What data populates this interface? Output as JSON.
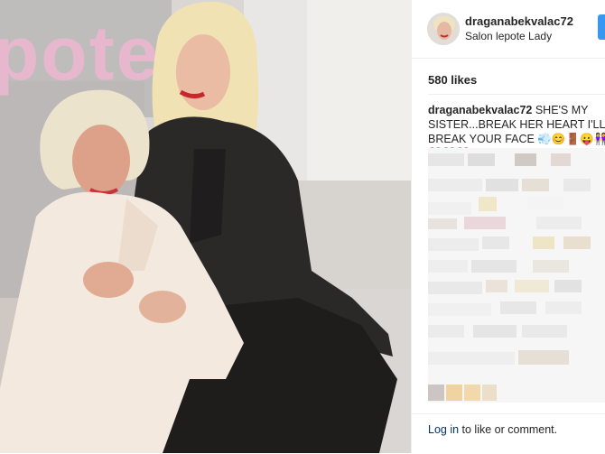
{
  "post": {
    "photo_desc": "photo",
    "sign_text": "pote"
  },
  "author": {
    "username": "draganabekvalac72",
    "location": "Salon lepote Lady"
  },
  "likes": "580 likes",
  "caption": {
    "username": "draganabekvalac72",
    "text": "SHE'S MY SISTER...BREAK HER HEART I'LL BREAK YOUR FACE",
    "emoji": "💨😊🚪😛👭❤️❤️❤️"
  },
  "footer": {
    "login_link": "Log in",
    "login_rest": " to like or comment."
  },
  "colors": {
    "accent": "#3897f0",
    "text": "#262626",
    "link": "#003569"
  }
}
